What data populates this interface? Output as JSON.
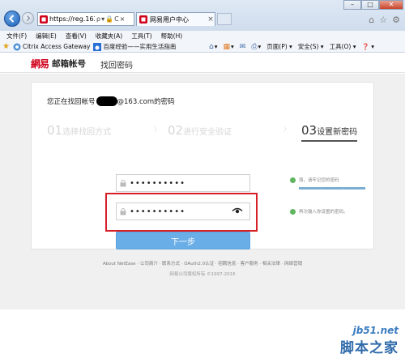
{
  "browser": {
    "address_url": "https://reg.163.co...",
    "address_tools": [
      "ρ",
      "▾",
      "🔒",
      "C",
      "×"
    ],
    "tab_label": "网易用户中心",
    "tab_close": "×",
    "window_controls": {
      "minimize": "–",
      "maximize": "□",
      "close": "✕"
    },
    "right_icons": [
      "⌂",
      "☆",
      "⚙"
    ]
  },
  "menu": [
    "文件(F)",
    "编辑(E)",
    "查看(V)",
    "收藏夹(A)",
    "工具(T)",
    "帮助(H)"
  ],
  "favorites_bar": {
    "items": [
      {
        "label": "Citrix Access Gateway",
        "icon": "citrix-icon"
      },
      {
        "label": "百度经验——实用生活指南",
        "icon": "baidu-icon"
      }
    ]
  },
  "command_bar": {
    "items": [
      "▾",
      "▾",
      "▾",
      "页面(P) ▾",
      "安全(S) ▾",
      "工具(O) ▾",
      "❓ ▾"
    ]
  },
  "site": {
    "logo_mark": "網易",
    "logo_title": "邮箱帐号",
    "section": "找回密码"
  },
  "account": {
    "prefix": "您正在找回帐号",
    "suffix": "@163.com的密码"
  },
  "steps": [
    {
      "num": "01",
      "label": "选择找回方式",
      "state": "done"
    },
    {
      "num": "02",
      "label": "进行安全验证",
      "state": "done"
    },
    {
      "num": "03",
      "label": "设置新密码",
      "state": "active"
    }
  ],
  "step_separator": "〉",
  "form": {
    "password_value": "••••••••••",
    "confirm_value": "••••••••••",
    "strength_hint": "强，请牢记您的密码",
    "strength_level": 1.0,
    "confirm_hint": "再次输入你设置的密码。",
    "next_button": "下一步"
  },
  "footer": {
    "links": "About NetEase  ·  公司简介  ·  联系方式  ·  OAuth2.0认证  ·  招聘信息  ·  客户服务  ·  相关法律  ·  网络营销",
    "copyright": "网易公司版权所有 ©1997-2016"
  },
  "watermark": {
    "site": "jb51.net",
    "name": "脚本之家"
  },
  "colors": {
    "accent_blue": "#6aaee8",
    "logo_red": "#d0021b",
    "annotation_red": "#d61f26",
    "ok_green": "#5fb65f"
  }
}
